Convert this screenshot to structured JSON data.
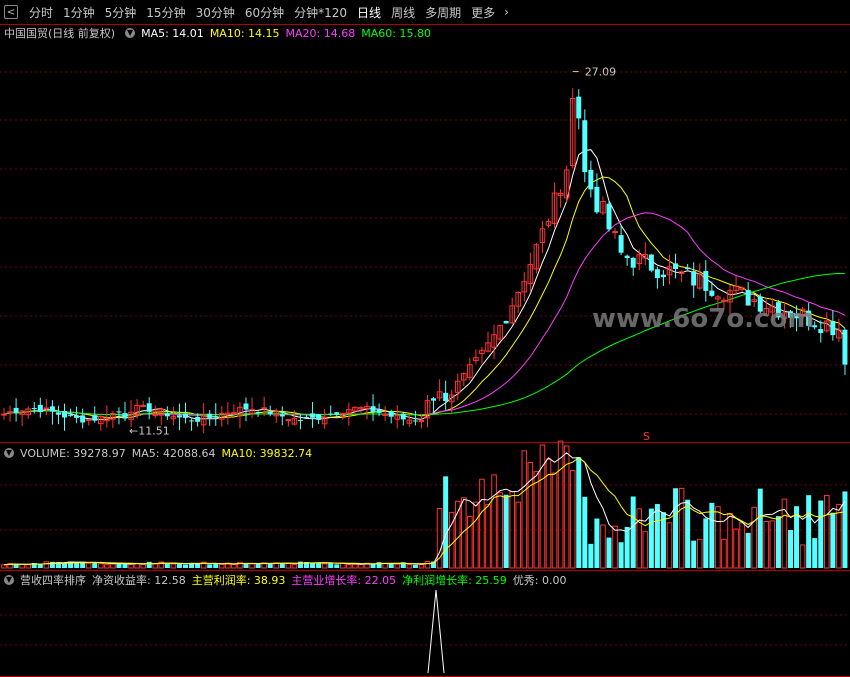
{
  "toolbar": {
    "items": [
      "分时",
      "1分钟",
      "5分钟",
      "15分钟",
      "30分钟",
      "60分钟",
      "分钟*120",
      "日线",
      "周线",
      "多周期",
      "更多"
    ],
    "active": "日线"
  },
  "main_panel": {
    "title": "中国国贸(日线 前复权)",
    "ma": [
      {
        "label": "MA5: 14.01",
        "color": "#ffffff"
      },
      {
        "label": "MA10: 14.15",
        "color": "#ffff00"
      },
      {
        "label": "MA20: 14.68",
        "color": "#ff3cff"
      },
      {
        "label": "MA60: 15.80",
        "color": "#00ff00"
      }
    ],
    "high_label": "27.09",
    "low_label": "11.51",
    "watermark": "www.6o7o.com",
    "signal": "S"
  },
  "volume_panel": {
    "items": [
      {
        "label": "VOLUME: 39278.97",
        "color": "#c8c8c8"
      },
      {
        "label": "MA5: 42088.64",
        "color": "#c8c8c8"
      },
      {
        "label": "MA10: 39832.74",
        "color": "#ffff00"
      }
    ]
  },
  "indicator_panel": {
    "items": [
      {
        "label": "营收四率排序",
        "color": "#c8c8c8"
      },
      {
        "label": "净资收益率: 12.58",
        "color": "#c8c8c8"
      },
      {
        "label": "主营利润率: 38.93",
        "color": "#ffff00"
      },
      {
        "label": "主营业增长率: 22.05",
        "color": "#ff3cff"
      },
      {
        "label": "净利润增长率: 25.59",
        "color": "#00ff00"
      },
      {
        "label": "优秀: 0.00",
        "color": "#c8c8c8"
      }
    ]
  },
  "chart_data": {
    "type": "candlestick",
    "y_range": [
      11.0,
      28.5
    ],
    "close_start": 11.8,
    "high": 27.09,
    "low": 11.51,
    "last_ma": {
      "MA5": 14.01,
      "MA10": 14.15,
      "MA20": 14.68,
      "MA60": 15.8
    },
    "last_volume": 39278.97
  },
  "colors": {
    "up": "#ff3232",
    "down": "#54ffff",
    "grid": "#7a0000",
    "axis": "#b00000"
  }
}
